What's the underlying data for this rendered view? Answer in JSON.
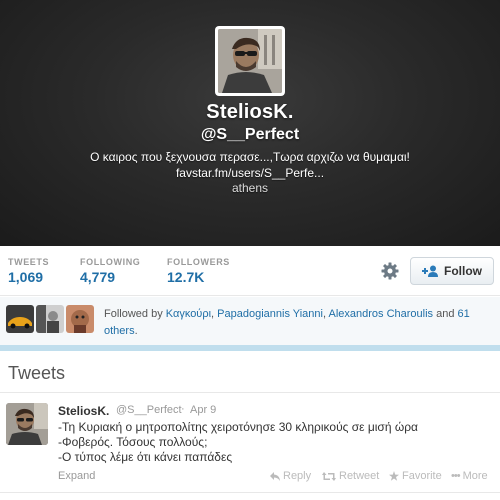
{
  "profile": {
    "name": "SteliosK.",
    "handle": "@S__Perfect",
    "bio": "Ο καιρος που ξεχνουσα περασε...,Τωρα αρχιζω να θυμαμαι!",
    "url": "favstar.fm/users/S__Perfe...",
    "location": "athens"
  },
  "stats": [
    {
      "label": "TWEETS",
      "value": "1,069"
    },
    {
      "label": "FOLLOWING",
      "value": "4,779"
    },
    {
      "label": "FOLLOWERS",
      "value": "12.7K"
    }
  ],
  "actions": {
    "follow_label": "Follow",
    "gear_icon": "gear-icon"
  },
  "followed_by": {
    "prefix": "Followed by ",
    "names": [
      "Καγκούρι",
      "Papadogiannis Yianni",
      "Alexandros Charoulis"
    ],
    "sep1": ", ",
    "sep2": ", ",
    "and_text": " and ",
    "others": "61 others",
    "end": "."
  },
  "tweets_section": {
    "title": "Tweets"
  },
  "tweet": {
    "name": "SteliosK.",
    "handle": "@S__Perfect",
    "dot": "·",
    "time": "Apr 9",
    "lines": [
      "-Τη Κυριακή ο μητροπολίτης χειροτόνησε 30 κληρικούς σε μισή ώρα",
      "-Φοβερός. Τόσους πολλούς;",
      "-Ο τύπος λέμε ότι κάνει παπάδες"
    ],
    "expand": "Expand",
    "reply": "Reply",
    "retweet": "Retweet",
    "favorite": "Favorite",
    "more": "More"
  },
  "colors": {
    "header_bg": "#2a2a2a",
    "link": "#1f6ea6",
    "strip": "#c0deed"
  }
}
